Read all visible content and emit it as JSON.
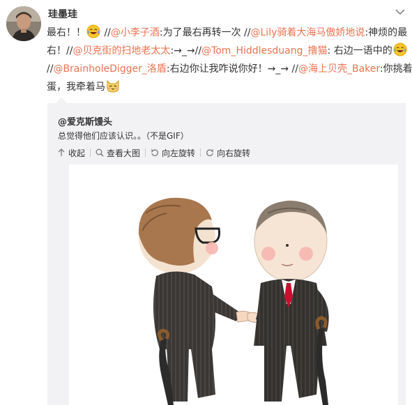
{
  "author": {
    "name": "珪墨珪"
  },
  "post": {
    "line1": {
      "t1": "最右！！",
      "t2": " //",
      "m1": "@小李子酒",
      "t3": ":为了最右再转一次 //",
      "m2": "@Lily骑着大海马傲娇地说",
      "t4": ":神烦的最"
    },
    "line2": {
      "t1": "右！//",
      "m1": "@贝克街的扫地老太太",
      "t2": ":→_→//",
      "m2": "@Tom_Hiddlesduang_撸猫",
      "t3": ": 右边一语中的"
    },
    "line3": {
      "t1": "//",
      "m1": "@BrainholeDigger_洛盾",
      "t2": ":右边你让我咋说你好！→_→ //",
      "m2": "@海上贝壳_Baker",
      "t3": ":你挑着"
    },
    "line4": {
      "t1": "蛋，我牵着马"
    }
  },
  "repost": {
    "author": "@爱克斯馒头",
    "text": "总觉得他们应该认识。。（不是GIF）",
    "actions": {
      "collapse": "收起",
      "view_large": "查看大图",
      "rotate_left": "向左旋转",
      "rotate_right": "向右旋转"
    }
  },
  "colors": {
    "mention": "#eb7350",
    "repost_bg": "#f2f2f5"
  },
  "icons": [
    "chevron-down-icon",
    "laugh-emoji-icon",
    "cat-emoji-icon",
    "arrow-up-icon",
    "magnifier-icon",
    "rotate-left-icon",
    "rotate-right-icon"
  ]
}
